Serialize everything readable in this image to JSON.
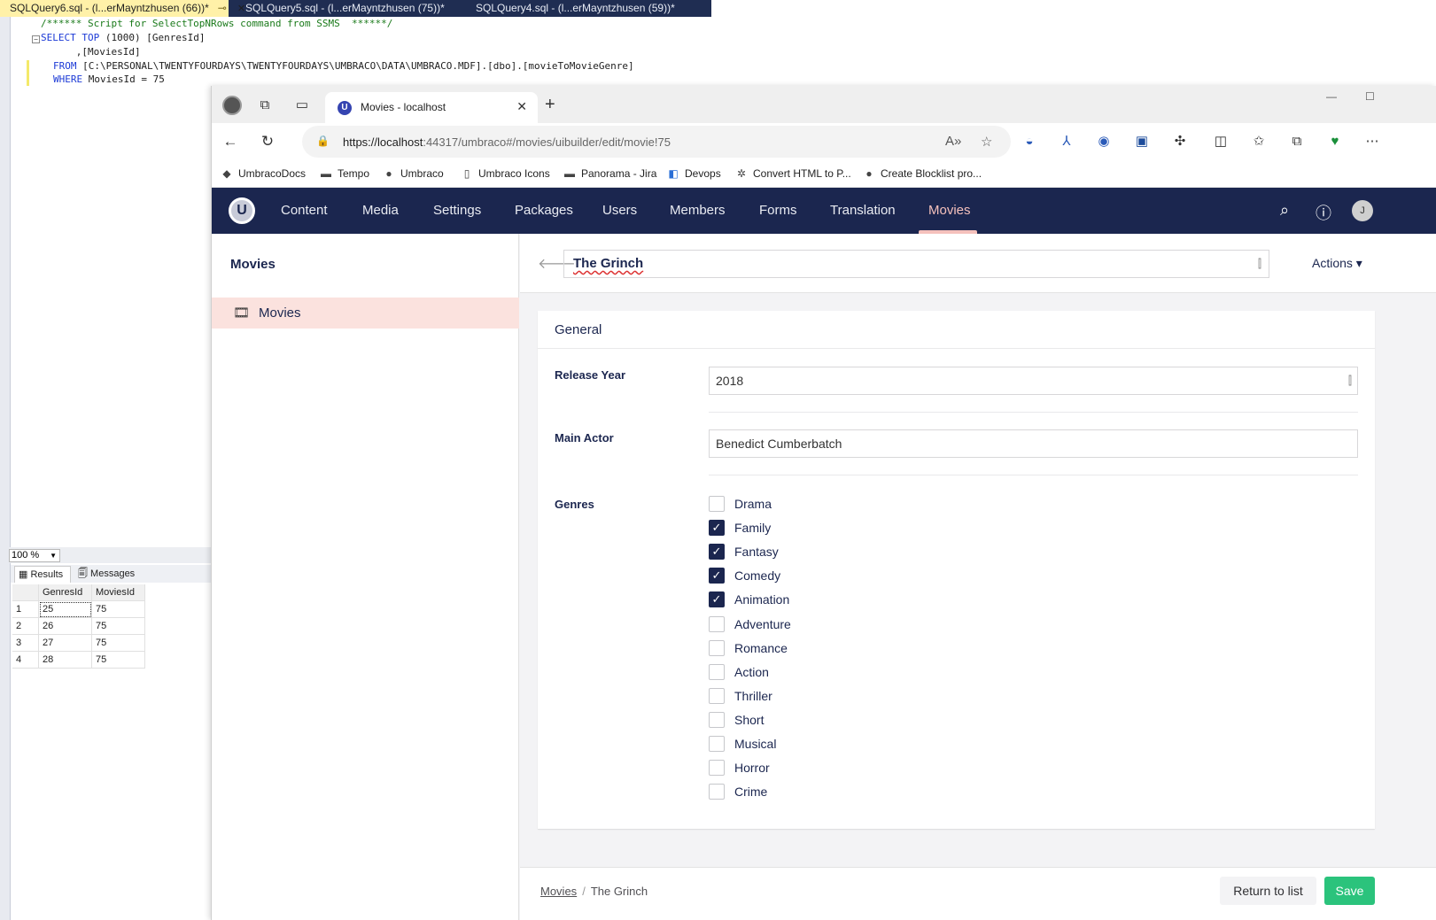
{
  "ssms": {
    "tabs": [
      {
        "label": "SQLQuery6.sql - (l...erMayntzhusen (66))*",
        "pin": "⊸",
        "close": "✕"
      },
      {
        "label": "SQLQuery5.sql - (l...erMayntzhusen (75))*"
      },
      {
        "label": "SQLQuery4.sql - (l...erMayntzhusen (59))*"
      }
    ],
    "query": {
      "comment": "/****** Script for SelectTopNRows command from SSMS  ******/",
      "select_kw": "SELECT TOP",
      "select_rest": " (1000) [GenresId]",
      "line2": "      ,[MoviesId]",
      "from_kw": "FROM",
      "from_rest": " [C:\\PERSONAL\\TWENTYFOURDAYS\\TWENTYFOURDAYS\\UMBRACO\\DATA\\UMBRACO.MDF].[dbo].[movieToMovieGenre]",
      "where_kw": "WHERE",
      "where_rest": " MoviesId = 75"
    },
    "zoom": "100 %",
    "result_tabs": [
      "Results",
      "Messages"
    ],
    "grid": {
      "columns": [
        "GenresId",
        "MoviesId"
      ],
      "rows": [
        {
          "n": "1",
          "genres_id": "25",
          "movies_id": "75"
        },
        {
          "n": "2",
          "genres_id": "26",
          "movies_id": "75"
        },
        {
          "n": "3",
          "genres_id": "27",
          "movies_id": "75"
        },
        {
          "n": "4",
          "genres_id": "28",
          "movies_id": "75"
        }
      ]
    }
  },
  "browser": {
    "tab_title": "Movies - localhost",
    "url_host": "https://localhost",
    "url_path": ":44317/umbraco#/movies/uibuilder/edit/movie!75",
    "bookmarks": [
      {
        "label": "UmbracoDocs",
        "icon": "umbraco-docs-icon"
      },
      {
        "label": "Tempo",
        "icon": "tempo-icon"
      },
      {
        "label": "Umbraco",
        "icon": "github-icon"
      },
      {
        "label": "Umbraco Icons",
        "icon": "document-icon"
      },
      {
        "label": "Panorama - Jira",
        "icon": "jira-icon"
      },
      {
        "label": "Devops",
        "icon": "devops-icon"
      },
      {
        "label": "Convert HTML to P...",
        "icon": "convert-icon"
      },
      {
        "label": "Create Blocklist pro...",
        "icon": "github-icon"
      }
    ]
  },
  "umbraco": {
    "logo": "U",
    "sections": [
      "Content",
      "Media",
      "Settings",
      "Packages",
      "Users",
      "Members",
      "Forms",
      "Translation",
      "Movies"
    ],
    "active_section": "Movies",
    "avatar": "J",
    "tree": {
      "title": "Movies",
      "item": "Movies"
    },
    "editor": {
      "name": "The Grinch",
      "actions": "Actions ▾",
      "group": "General",
      "release_year_label": "Release Year",
      "release_year": "2018",
      "main_actor_label": "Main Actor",
      "main_actor": "Benedict Cumberbatch",
      "genres_label": "Genres",
      "genres": [
        {
          "label": "Drama",
          "checked": false
        },
        {
          "label": "Family",
          "checked": true
        },
        {
          "label": "Fantasy",
          "checked": true
        },
        {
          "label": "Comedy",
          "checked": true
        },
        {
          "label": "Animation",
          "checked": true
        },
        {
          "label": "Adventure",
          "checked": false
        },
        {
          "label": "Romance",
          "checked": false
        },
        {
          "label": "Action",
          "checked": false
        },
        {
          "label": "Thriller",
          "checked": false
        },
        {
          "label": "Short",
          "checked": false
        },
        {
          "label": "Musical",
          "checked": false
        },
        {
          "label": "Horror",
          "checked": false
        },
        {
          "label": "Crime",
          "checked": false
        }
      ]
    },
    "footer": {
      "crumb_root": "Movies",
      "crumb_current": "The Grinch",
      "return_label": "Return to list",
      "save_label": "Save"
    }
  }
}
